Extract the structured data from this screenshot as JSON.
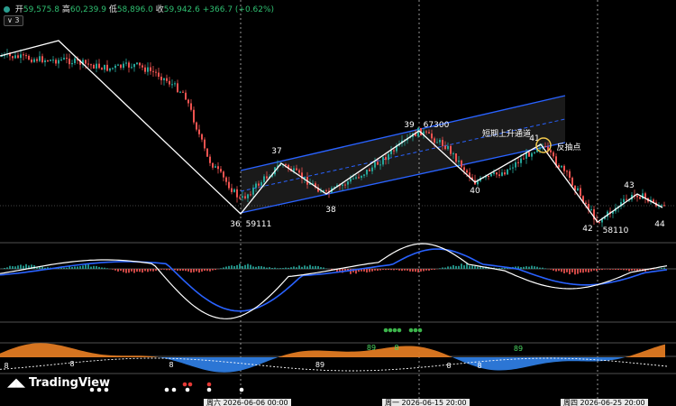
{
  "header": {
    "open_label": "开",
    "open_value": "59,575.8",
    "high_label": "高",
    "high_value": "60,239.9",
    "low_label": "低",
    "low_value": "58,896.0",
    "close_label": "收",
    "close_value": "59,942.6 +366.7 (+0.62%)",
    "indicator_count": "∨ 3"
  },
  "watermark": {
    "text": "TradingView"
  },
  "x_axis": {
    "dates": [
      "周六 2026-06-06 00:00",
      "周一 2026-06-15 20:00",
      "周四 2026-06-25 20:00"
    ]
  },
  "chart_data": {
    "type": "candlestick",
    "annotations": {
      "wave_points": [
        "36",
        "37",
        "38",
        "39",
        "40",
        "41",
        "42",
        "43",
        "44"
      ],
      "price_labels": [
        "59111",
        "67300",
        "58110"
      ],
      "channel_label": "短期上升通道",
      "reversal_label": "反抽点"
    },
    "price_path": [
      62.0,
      65.0,
      68.0,
      65.5,
      63.5,
      62.0,
      64.0,
      63.5,
      61.0,
      59.11,
      61.0,
      63.5,
      62.5,
      60.5,
      62.0,
      64.0,
      65.5,
      67.3,
      66.0,
      64.5,
      62.5,
      64.0,
      65.5,
      64.0,
      62.0,
      60.5,
      59.0,
      58.11,
      59.5,
      60.0,
      59.4,
      59.94
    ],
    "macd": {
      "histogram_colors": {
        "positive": "#26a69a",
        "negative": "#ef5350"
      }
    },
    "oscillator_labels": [
      "8",
      "8",
      "8",
      "89",
      "89",
      "8",
      "8",
      "8",
      "89"
    ],
    "colors": {
      "up": "#26a69a",
      "down": "#ef5350",
      "zigzag": "#ffffff",
      "channel": "#2962ff",
      "macd_line": "#ffffff",
      "signal_line": "#2962ff",
      "orange_area": "#e07a22",
      "blue_area": "#2e7ce0"
    }
  }
}
